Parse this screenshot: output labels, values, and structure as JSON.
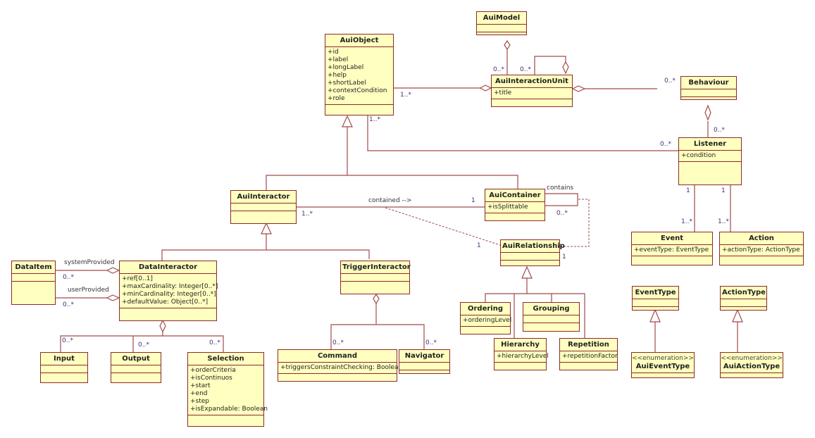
{
  "classes": {
    "AuiModel": {
      "name": "AuiModel",
      "attributes": []
    },
    "AuiObject": {
      "name": "AuiObject",
      "attributes": [
        "+id",
        "+label",
        "+longLabel",
        "+help",
        "+shortLabel",
        "+contextCondition",
        "+role"
      ]
    },
    "AuiInteractionUnit": {
      "name": "AuiInteractionUnit",
      "attributes": [
        "+title"
      ]
    },
    "Behaviour": {
      "name": "Behaviour",
      "attributes": []
    },
    "Listener": {
      "name": "Listener",
      "attributes": [
        "+condition"
      ]
    },
    "Event": {
      "name": "Event",
      "attributes": [
        "+eventType: EventType"
      ]
    },
    "Action": {
      "name": "Action",
      "attributes": [
        "+actionType: ActionType"
      ]
    },
    "AuiInteractor": {
      "name": "AuiInteractor",
      "attributes": []
    },
    "AuiContainer": {
      "name": "AuiContainer",
      "attributes": [
        "+isSplittable"
      ]
    },
    "AuiRelationship": {
      "name": "AuiRelationship",
      "attributes": []
    },
    "DataItem": {
      "name": "DataItem",
      "attributes": []
    },
    "DataInteractor": {
      "name": "DataInteractor",
      "attributes": [
        "+ref[0..1]",
        "+maxCardinality: Integer[0..*]",
        "+minCardinality: Integer[0..*]",
        "+defaultValue: Object[0..*]"
      ]
    },
    "TriggerInteractor": {
      "name": "TriggerInteractor",
      "attributes": []
    },
    "Input": {
      "name": "Input",
      "attributes": []
    },
    "Output": {
      "name": "Output",
      "attributes": []
    },
    "Selection": {
      "name": "Selection",
      "attributes": [
        "+orderCriteria",
        "+isContinuos",
        "+start",
        "+end",
        "+step",
        "+isExpandable: Boolean"
      ]
    },
    "Command": {
      "name": "Command",
      "attributes": [
        "+triggersConstraintChecking: Boolean"
      ]
    },
    "Navigator": {
      "name": "Navigator",
      "attributes": []
    },
    "Ordering": {
      "name": "Ordering",
      "attributes": [
        "+orderingLevel"
      ]
    },
    "Grouping": {
      "name": "Grouping",
      "attributes": []
    },
    "Hierarchy": {
      "name": "Hierarchy",
      "attributes": [
        "+hierarchyLevel"
      ]
    },
    "Repetition": {
      "name": "Repetition",
      "attributes": [
        "+repetitionFactor"
      ]
    },
    "EventType": {
      "name": "EventType",
      "attributes": []
    },
    "ActionType": {
      "name": "ActionType",
      "attributes": []
    },
    "AuiEventType": {
      "name": "AuiEventType",
      "stereotype": "<<enumeration>>",
      "attributes": []
    },
    "AuiActionType": {
      "name": "AuiActionType",
      "stereotype": "<<enumeration>>",
      "attributes": []
    }
  },
  "labels": {
    "m_model_iu": "0..*",
    "m_iu_self": "0..*",
    "m_obj_iu": "1..*",
    "m_obj_listener_src": "1..*",
    "m_iu_behaviour": "0..*",
    "m_behaviour_listener": "0..*",
    "m_listener_obj": "0..*",
    "m_listener_event_src": "1",
    "m_listener_action_src": "1",
    "m_event": "1..*",
    "m_action": "1..*",
    "m_interactor": "1..*",
    "m_container": "1",
    "m_container_self": "0..*",
    "m_rel_left": "1",
    "m_rel_right": "1",
    "r_contained": "contained -->",
    "r_contains": "contains",
    "r_system": "systemProvided",
    "r_user": "userProvided",
    "m_dataitem_sys": "0..*",
    "m_dataitem_user": "0..*",
    "m_input": "0..*",
    "m_output": "0..*",
    "m_selection": "0..*",
    "m_command": "0..*",
    "m_navigator": "0..*"
  },
  "colors": {
    "line": "#a24a4a",
    "fill": "#ffffc0",
    "border": "#8b2a2a"
  }
}
